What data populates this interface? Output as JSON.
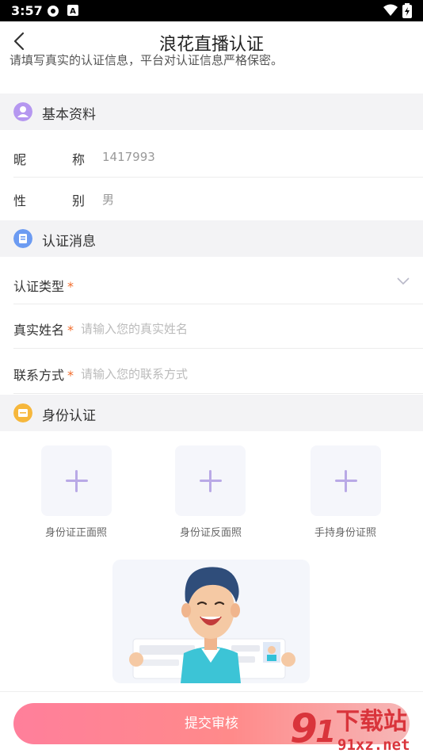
{
  "status_bar": {
    "time": "3:57",
    "icons": [
      "settings-icon",
      "a-icon",
      "wifi-icon",
      "battery-charging-icon"
    ]
  },
  "app_bar": {
    "title": "浪花直播认证",
    "back_icon": "chevron-left-icon"
  },
  "notice": {
    "text": "请填写真实的认证信息，平台对认证信息严格保密。"
  },
  "sections": {
    "basic": {
      "title": "基本资料",
      "icon": "person-icon",
      "color": "#b597f0"
    },
    "auth": {
      "title": "认证消息",
      "icon": "document-icon",
      "color": "#6c9bf2"
    },
    "identity": {
      "title": "身份认证",
      "icon": "card-icon",
      "color": "#f6b73c"
    }
  },
  "basic_info": {
    "nickname_label_1": "昵",
    "nickname_label_2": "称",
    "nickname_value": "1417993",
    "gender_label_1": "性",
    "gender_label_2": "别",
    "gender_value": "男"
  },
  "auth_form": {
    "type_label": "认证类型",
    "name_label": "真实姓名",
    "name_placeholder": "请输入您的真实姓名",
    "contact_label": "联系方式",
    "contact_placeholder": "请输入您的联系方式",
    "required_mark": "*"
  },
  "uploads": [
    {
      "caption": "身份证正面照"
    },
    {
      "caption": "身份证反面照"
    },
    {
      "caption": "手持身份证照"
    }
  ],
  "submit_label": "提交审核",
  "watermark": {
    "main": "下载站",
    "sub": "91xz.net"
  },
  "colors": {
    "accent_pink": "#ff7f9b",
    "required": "#f26b2a",
    "plus": "#b9a9e6"
  }
}
